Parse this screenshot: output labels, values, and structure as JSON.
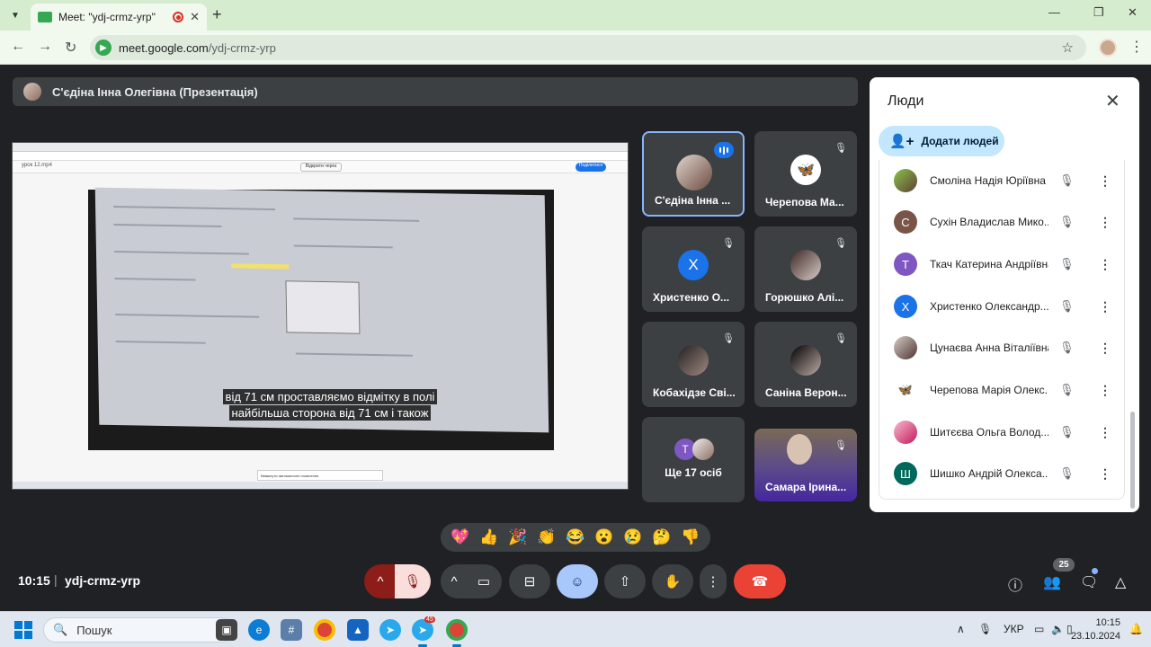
{
  "browser": {
    "tab_title": "Meet: \"ydj-crmz-yrp\"",
    "url_host": "meet.google.com",
    "url_path": "/ydj-crmz-yrp"
  },
  "presenter_bar": {
    "label": "С'єдіна Інна Олегівна (Презентація)"
  },
  "screen_share": {
    "file_label": "урок 12.mp4",
    "dropdown_label": "Відкрити через",
    "share_button": "Поділитися",
    "caption_line1": "від 71 см проставляємо відмітку в полі",
    "caption_line2": "найбільша сторона від 71 см і також",
    "notice": "Ввімкнути автоматичне оновлення"
  },
  "tiles": [
    {
      "name": "С'єдіна Інна ...",
      "avatar": "photo",
      "state": "speaking"
    },
    {
      "name": "Черепова Ма...",
      "avatar": "butterfly",
      "state": "muted"
    },
    {
      "name": "Христенко О...",
      "avatar": "Х",
      "avatar_color": "#1a73e8",
      "state": "muted"
    },
    {
      "name": "Горюшко Алі...",
      "avatar": "photo",
      "state": "muted"
    },
    {
      "name": "Кобахідзе Сві...",
      "avatar": "photo",
      "state": "muted"
    },
    {
      "name": "Саніна Верон...",
      "avatar": "photo",
      "state": "muted"
    },
    {
      "name": "Ще 17 осіб",
      "avatar": "Т",
      "avatar_color": "#7e57c2"
    },
    {
      "name": "Самара Ірина...",
      "avatar": "camera",
      "state": "muted"
    }
  ],
  "people_panel": {
    "title": "Люди",
    "add_button": "Додати людей",
    "people": [
      {
        "name": "Смоліна Надія Юріївна",
        "avatar": "photo",
        "color": "#8bc34a"
      },
      {
        "name": "Сухін Владислав Мико...",
        "avatar": "С",
        "color": "#795548"
      },
      {
        "name": "Ткач Катерина Андріївна",
        "avatar": "Т",
        "color": "#7e57c2"
      },
      {
        "name": "Христенко Олександр...",
        "avatar": "Х",
        "color": "#1a73e8"
      },
      {
        "name": "Цунаєва Анна Віталіївна",
        "avatar": "photo",
        "color": "#a1887f"
      },
      {
        "name": "Черепова Марія Олекс...",
        "avatar": "butterfly",
        "color": "#ffffff"
      },
      {
        "name": "Шитєєва Ольга Волод...",
        "avatar": "photo",
        "color": "#c2185b"
      },
      {
        "name": "Шишко Андрій Олекса...",
        "avatar": "Ш",
        "color": "#00695c"
      }
    ]
  },
  "reactions": [
    "💖",
    "👍",
    "🎉",
    "👏",
    "😂",
    "😮",
    "😢",
    "🤔",
    "👎"
  ],
  "meeting": {
    "time": "10:15",
    "separator": "|",
    "code": "ydj-crmz-yrp",
    "participants_count": "25"
  },
  "taskbar": {
    "search_placeholder": "Пошук",
    "language": "УКР",
    "time": "10:15",
    "date": "23.10.2024",
    "telegram_badge": "45"
  }
}
